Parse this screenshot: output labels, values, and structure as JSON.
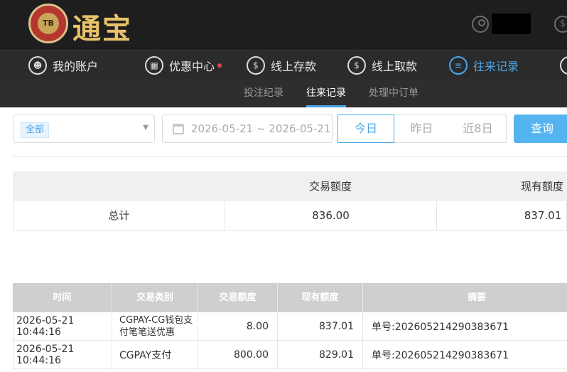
{
  "header": {
    "logo_mark": "TB",
    "logo_text": "通宝",
    "money_symbol": "$"
  },
  "nav": {
    "items": [
      {
        "label": "我的账户",
        "icon": "user-circle-icon",
        "glyph": "👤"
      },
      {
        "label": "优惠中心",
        "icon": "gift-icon",
        "glyph": "🎁"
      },
      {
        "label": "线上存款",
        "icon": "deposit-icon",
        "glyph": "$"
      },
      {
        "label": "线上取款",
        "icon": "withdraw-icon",
        "glyph": "$"
      },
      {
        "label": "往来记录",
        "icon": "records-icon",
        "glyph": "≡"
      }
    ]
  },
  "subnav": {
    "items": [
      "投注纪录",
      "往来记录",
      "处理中订单"
    ]
  },
  "filters": {
    "type_selected": "全部",
    "date_range": "2026-05-21 ~ 2026-05-21",
    "ranges": [
      "今日",
      "昨日",
      "近8日"
    ],
    "query_label": "查询"
  },
  "summary": {
    "headers": [
      "",
      "交易额度",
      "现有额度"
    ],
    "row": {
      "label": "总计",
      "amount": "836.00",
      "balance": "837.01"
    }
  },
  "detail": {
    "headers": [
      "时间",
      "交易类别",
      "交易额度",
      "现有额度",
      "摘要"
    ],
    "rows": [
      {
        "time": "2026-05-21 10:44:16",
        "type": "CGPAY-CG钱包支付笔笔送优惠",
        "amount": "8.00",
        "balance": "837.01",
        "summary": "单号:2026052142903836​71"
      },
      {
        "time": "2026-05-21 10:44:16",
        "type": "CGPAY支付",
        "amount": "800.00",
        "balance": "829.01",
        "summary": "单号:202605214290383671"
      }
    ]
  },
  "colors": {
    "accent": "#4aa8e8",
    "topbar": "#1e1e1e",
    "logo_gold": "#e8c26a"
  }
}
